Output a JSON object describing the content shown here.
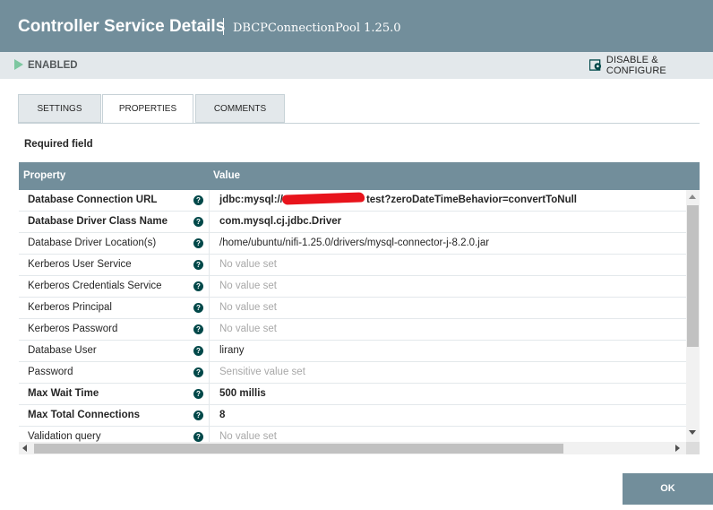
{
  "header": {
    "title": "Controller Service Details",
    "subtitle": "DBCPConnectionPool 1.25.0"
  },
  "status": {
    "state": "ENABLED",
    "state_color": "#7dc7a0",
    "disable_configure_label": "DISABLE & CONFIGURE"
  },
  "tabs": [
    {
      "label": "SETTINGS"
    },
    {
      "label": "PROPERTIES"
    },
    {
      "label": "COMMENTS"
    }
  ],
  "active_tab": "PROPERTIES",
  "required_label": "Required field",
  "table": {
    "headers": {
      "property": "Property",
      "value": "Value"
    },
    "rows": [
      {
        "name": "Database Connection URL",
        "value": "jdbc:mysql://",
        "value_suffix": "test?zeroDateTimeBehavior=convertToNull",
        "required": true,
        "empty": false
      },
      {
        "name": "Database Driver Class Name",
        "value": "com.mysql.cj.jdbc.Driver",
        "required": true,
        "empty": false
      },
      {
        "name": "Database Driver Location(s)",
        "value": "/home/ubuntu/nifi-1.25.0/drivers/mysql-connector-j-8.2.0.jar",
        "required": false,
        "empty": false
      },
      {
        "name": "Kerberos User Service",
        "value": "No value set",
        "required": false,
        "empty": true
      },
      {
        "name": "Kerberos Credentials Service",
        "value": "No value set",
        "required": false,
        "empty": true
      },
      {
        "name": "Kerberos Principal",
        "value": "No value set",
        "required": false,
        "empty": true
      },
      {
        "name": "Kerberos Password",
        "value": "No value set",
        "required": false,
        "empty": true
      },
      {
        "name": "Database User",
        "value": "lirany",
        "required": false,
        "empty": false
      },
      {
        "name": "Password",
        "value": "Sensitive value set",
        "required": false,
        "empty": true
      },
      {
        "name": "Max Wait Time",
        "value": "500 millis",
        "required": true,
        "empty": false
      },
      {
        "name": "Max Total Connections",
        "value": "8",
        "required": true,
        "empty": false
      },
      {
        "name": "Validation query",
        "value": "No value set",
        "required": false,
        "empty": true
      }
    ]
  },
  "ok_label": "OK",
  "colors": {
    "header_bg": "#728e9b",
    "status_bg": "#e3e8eb",
    "help_icon": "#004849",
    "redaction": "#e8141c"
  }
}
